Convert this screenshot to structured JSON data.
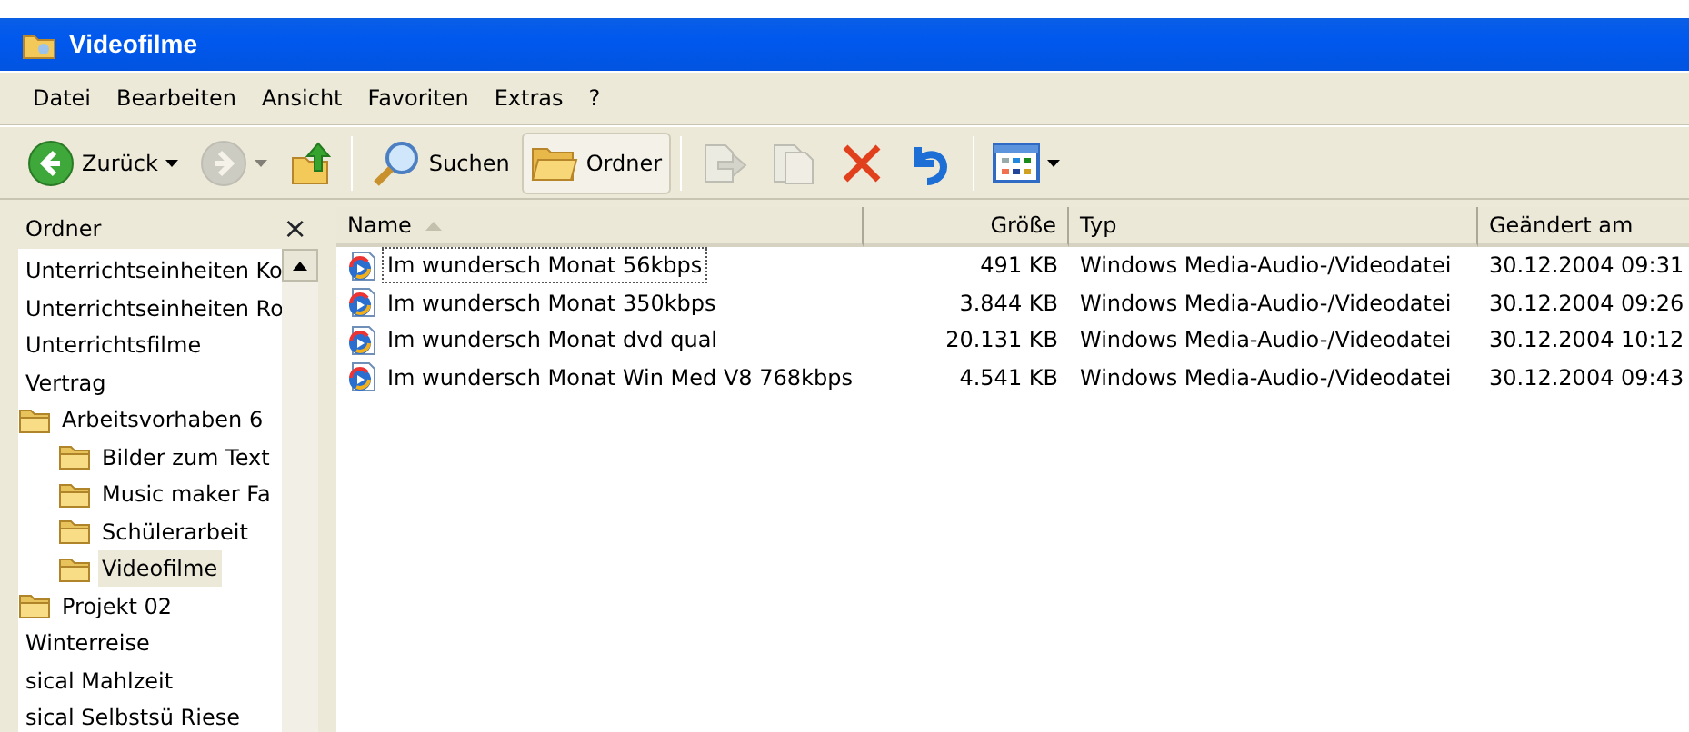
{
  "window": {
    "title": "Videofilme"
  },
  "menu": [
    "Datei",
    "Bearbeiten",
    "Ansicht",
    "Favoriten",
    "Extras",
    "?"
  ],
  "toolbar": [
    {
      "kind": "back",
      "label": "Zurück",
      "disabled": false,
      "dropdown": true,
      "selected": false
    },
    {
      "kind": "forward",
      "disabled": true,
      "dropdown": true,
      "selected": false
    },
    {
      "kind": "up",
      "disabled": false,
      "dropdown": false,
      "selected": false
    },
    {
      "kind": "sep"
    },
    {
      "kind": "search",
      "label": "Suchen",
      "disabled": false,
      "dropdown": false,
      "selected": false
    },
    {
      "kind": "folders",
      "label": "Ordner",
      "disabled": false,
      "dropdown": false,
      "selected": true
    },
    {
      "kind": "sep"
    },
    {
      "kind": "move",
      "disabled": true,
      "dropdown": false,
      "selected": false
    },
    {
      "kind": "copy",
      "disabled": true,
      "dropdown": false,
      "selected": false
    },
    {
      "kind": "delete",
      "disabled": false,
      "dropdown": false,
      "selected": false
    },
    {
      "kind": "undo",
      "disabled": false,
      "dropdown": false,
      "selected": false
    },
    {
      "kind": "sep"
    },
    {
      "kind": "views",
      "disabled": false,
      "dropdown": true,
      "selected": false
    }
  ],
  "folders_pane": {
    "title": "Ordner",
    "close": "×",
    "tree": [
      {
        "label": "Unterrichtseinheiten Ko",
        "kind": "plain",
        "selected": false
      },
      {
        "label": "Unterrichtseinheiten Ro",
        "kind": "plain",
        "selected": false
      },
      {
        "label": "Unterrichtsfilme",
        "kind": "plain",
        "selected": false
      },
      {
        "label": "Vertrag",
        "kind": "plain",
        "selected": false
      },
      {
        "label": "Arbeitsvorhaben 6",
        "kind": "folder",
        "selected": false,
        "children": [
          {
            "label": "Bilder zum Text",
            "kind": "folder",
            "selected": false
          },
          {
            "label": "Music maker Fa",
            "kind": "folder",
            "selected": false
          },
          {
            "label": "Schülerarbeit",
            "kind": "folder",
            "selected": false
          },
          {
            "label": "Videofilme",
            "kind": "folder",
            "selected": true
          }
        ]
      },
      {
        "label": "Projekt 02",
        "kind": "folder",
        "selected": false
      },
      {
        "label": "Winterreise",
        "kind": "plain",
        "selected": false
      },
      {
        "label": "sical Mahlzeit",
        "kind": "plain",
        "selected": false
      },
      {
        "label": "sical Selbstsü Riese",
        "kind": "plain",
        "selected": false
      }
    ]
  },
  "file_list": {
    "columns": [
      {
        "label": "Name",
        "sorted": true
      },
      {
        "label": "Größe",
        "sorted": false
      },
      {
        "label": "Typ",
        "sorted": false
      },
      {
        "label": "Geändert am",
        "sorted": false
      }
    ],
    "rows": [
      {
        "name": "Im wundersch Monat 56kbps",
        "size": "491 KB",
        "type": "Windows Media-Audio-/Videodatei",
        "modified": "30.12.2004 09:31",
        "focused": true
      },
      {
        "name": "Im wundersch Monat 350kbps",
        "size": "3.844 KB",
        "type": "Windows Media-Audio-/Videodatei",
        "modified": "30.12.2004 09:26",
        "focused": false
      },
      {
        "name": "Im wundersch Monat dvd qual",
        "size": "20.131 KB",
        "type": "Windows Media-Audio-/Videodatei",
        "modified": "30.12.2004 10:12",
        "focused": false
      },
      {
        "name": "Im wundersch Monat Win Med V8 768kbps",
        "size": "4.541 KB",
        "type": "Windows Media-Audio-/Videodatei",
        "modified": "30.12.2004 09:43",
        "focused": false
      }
    ]
  }
}
